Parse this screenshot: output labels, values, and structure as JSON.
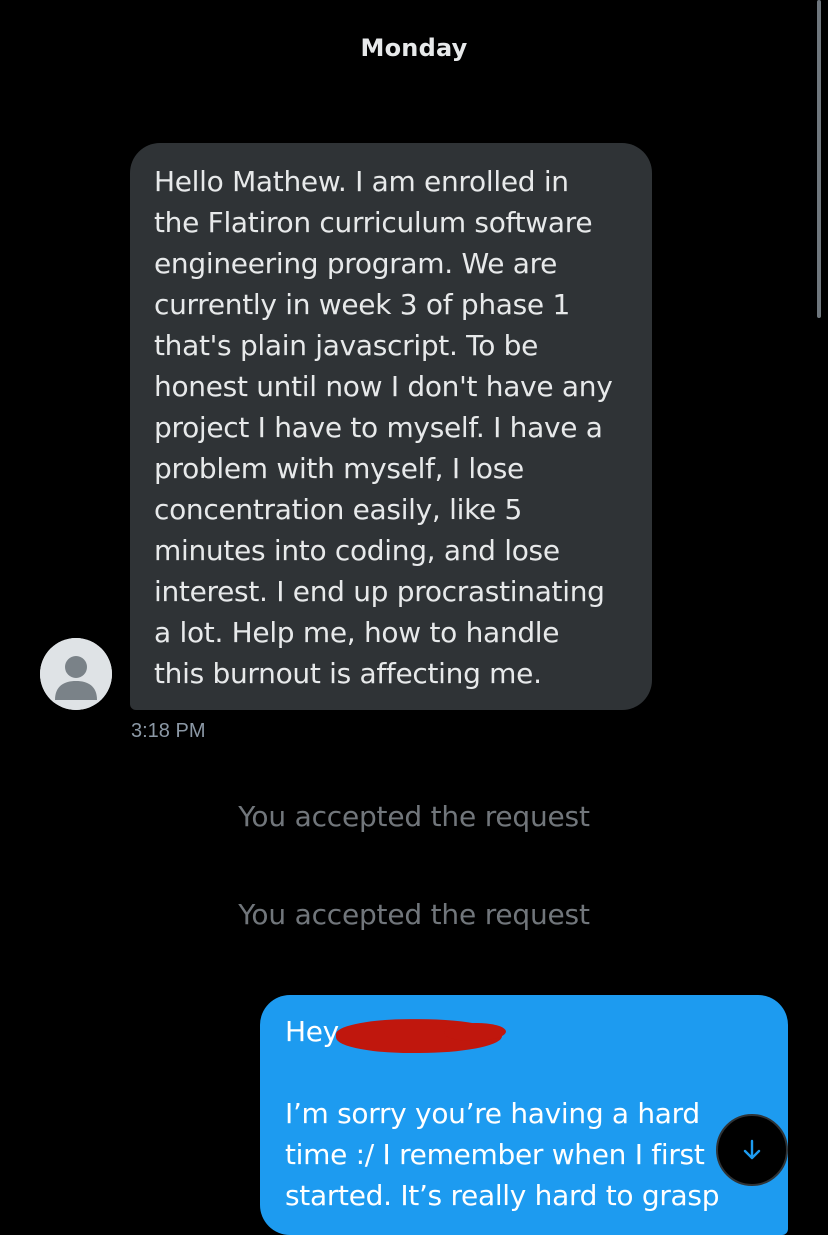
{
  "conversation": {
    "day_label": "Monday",
    "incoming_message": {
      "lines": [
        "Hello Mathew. I am enrolled in",
        "the Flatiron curriculum software",
        "engineering program. We are",
        "currently in week 3 of phase 1",
        "that's plain javascript. To be",
        "honest until now I don't have any",
        "project I have to myself. I have a",
        "problem with myself, I lose",
        "concentration easily, like 5",
        "minutes into coding, and lose",
        "interest. I end up procrastinating",
        "a lot. Help me, how to handle",
        "this burnout is affecting me."
      ],
      "time": "3:18 PM"
    },
    "system_messages": [
      "You accepted the request",
      "You accepted the request"
    ],
    "outgoing_message": {
      "lines": [
        "Hey",
        "",
        "I’m sorry you’re having a hard",
        "time :/ I remember when I first",
        "started. It’s really hard to grasp"
      ]
    }
  },
  "icons": {
    "avatar": "default-profile-icon",
    "scroll_down": "arrow-down-icon",
    "redaction": "red-scribble-redaction"
  },
  "colors": {
    "background": "#000000",
    "incoming_bubble": "#2f3336",
    "outgoing_bubble": "#1d9bf0",
    "muted_text": "#71767b",
    "redaction": "#c0170d"
  }
}
